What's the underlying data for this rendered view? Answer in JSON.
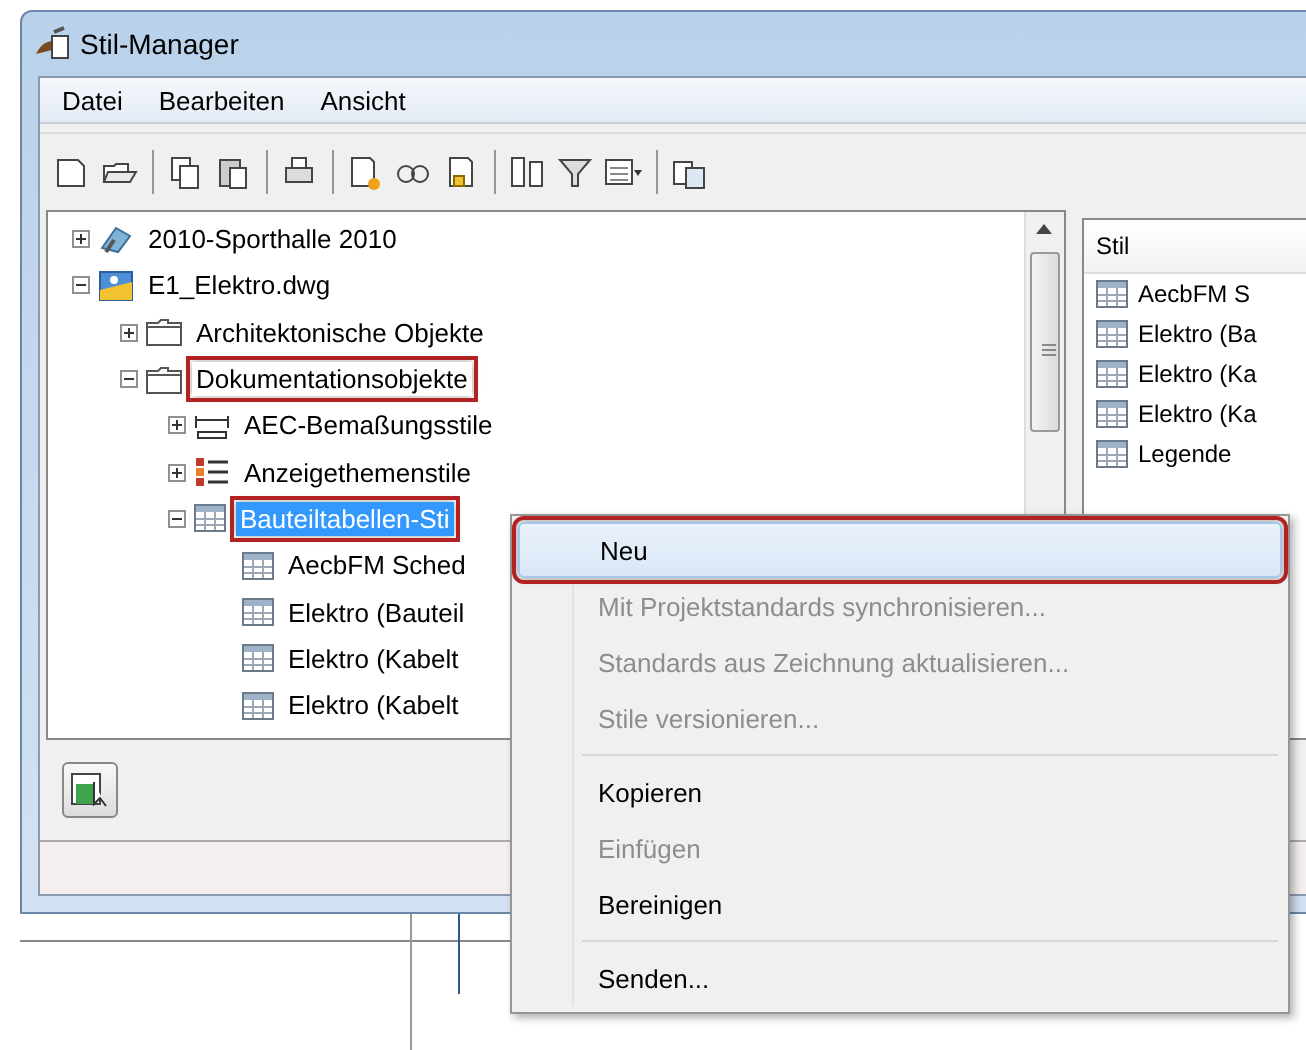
{
  "window": {
    "title": "Stil-Manager"
  },
  "menu_bar": [
    "Datei",
    "Bearbeiten",
    "Ansicht"
  ],
  "tree": [
    {
      "label": "2010-Sporthalle 2010",
      "kind": "project",
      "expanded": false,
      "selected": false,
      "highlighted": false
    },
    {
      "label": "E1_Elektro.dwg",
      "kind": "drawing",
      "expanded": true,
      "selected": false,
      "highlighted": false,
      "children": [
        {
          "label": "Architektonische Objekte",
          "kind": "folder",
          "expanded": false,
          "selected": false,
          "highlighted": false
        },
        {
          "label": "Dokumentationsobjekte",
          "kind": "folder",
          "expanded": true,
          "selected": false,
          "highlighted": true,
          "children": [
            {
              "label": "AEC-Bemaßungsstile",
              "kind": "dimension",
              "expanded": false,
              "selected": false,
              "highlighted": false
            },
            {
              "label": "Anzeigethemenstile",
              "kind": "theme",
              "expanded": false,
              "selected": false,
              "highlighted": false
            },
            {
              "label": "Bauteiltabellen-Sti",
              "kind": "table",
              "expanded": true,
              "selected": true,
              "highlighted": true,
              "children": [
                {
                  "label": "AecbFM Sched",
                  "kind": "table",
                  "selected": false,
                  "highlighted": false
                },
                {
                  "label": "Elektro (Bauteil",
                  "kind": "table",
                  "selected": false,
                  "highlighted": false
                },
                {
                  "label": "Elektro (Kabelt",
                  "kind": "table",
                  "selected": false,
                  "highlighted": false
                },
                {
                  "label": "Elektro (Kabelt",
                  "kind": "table",
                  "selected": false,
                  "highlighted": false
                }
              ]
            }
          ]
        }
      ]
    }
  ],
  "style_list": {
    "column": "Stil",
    "rows": [
      "AecbFM S",
      "Elektro (Ba",
      "Elektro (Ka",
      "Elektro (Ka",
      "Legende"
    ]
  },
  "context_menu": [
    {
      "label": "Neu",
      "kind": "item",
      "disabled": false,
      "selected": true,
      "highlighted": true
    },
    {
      "label": "Mit Projektstandards synchronisieren...",
      "kind": "item",
      "disabled": true,
      "selected": false,
      "highlighted": false
    },
    {
      "label": "Standards aus Zeichnung aktualisieren...",
      "kind": "item",
      "disabled": true,
      "selected": false,
      "highlighted": false
    },
    {
      "label": "Stile versionieren...",
      "kind": "item",
      "disabled": true,
      "selected": false,
      "highlighted": false
    },
    {
      "kind": "separator"
    },
    {
      "label": "Kopieren",
      "kind": "item",
      "disabled": false,
      "selected": false,
      "highlighted": false
    },
    {
      "label": "Einfügen",
      "kind": "item",
      "disabled": true,
      "selected": false,
      "highlighted": false
    },
    {
      "label": "Bereinigen",
      "kind": "item",
      "disabled": false,
      "selected": false,
      "highlighted": false
    },
    {
      "kind": "separator"
    },
    {
      "label": "Senden...",
      "kind": "item",
      "disabled": false,
      "selected": false,
      "highlighted": false
    }
  ]
}
